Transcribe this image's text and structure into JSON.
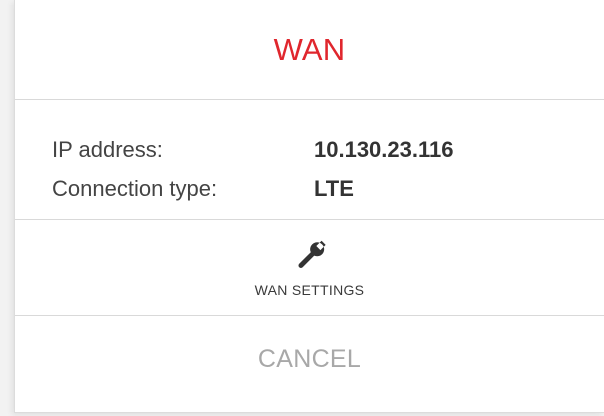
{
  "dialog": {
    "title": "WAN",
    "title_color": "#e0262d",
    "fields": [
      {
        "label": "IP address:",
        "value": "10.130.23.116"
      },
      {
        "label": "Connection type:",
        "value": "LTE"
      }
    ],
    "settings_button": {
      "icon": "wrench-icon",
      "label": "WAN SETTINGS"
    },
    "cancel_button": {
      "label": "CANCEL"
    }
  }
}
